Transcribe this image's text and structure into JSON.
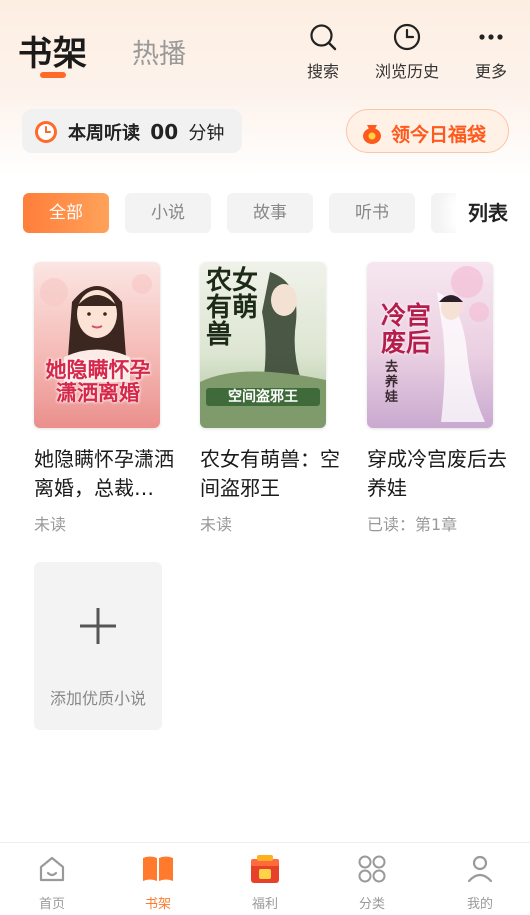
{
  "header": {
    "tabs": [
      {
        "label": "书架",
        "active": true
      },
      {
        "label": "热播",
        "active": false
      }
    ],
    "actions": [
      {
        "label": "搜索",
        "icon": "search-icon"
      },
      {
        "label": "浏览历史",
        "icon": "clock-icon"
      },
      {
        "label": "更多",
        "icon": "more-icon"
      }
    ]
  },
  "stats": {
    "label": "本周听读",
    "value": "00",
    "unit": "分钟",
    "bag_label": "领今日福袋"
  },
  "filters": {
    "chips": [
      "全部",
      "小说",
      "故事",
      "听书"
    ],
    "active": "全部",
    "view_toggle": "列表"
  },
  "books": [
    {
      "title": "她隐瞒怀孕潇洒离婚，总裁…",
      "status": "未读",
      "cover_text": "她隐瞒怀孕潇洒离婚",
      "cover_colors": [
        "#f9d6d4",
        "#f2a7a4"
      ]
    },
    {
      "title": "农女有萌兽：空间盗邪王",
      "status": "未读",
      "cover_text": "农女有萌兽",
      "cover_subtext": "空间盗邪王",
      "cover_colors": [
        "#e8efe2",
        "#b5c9a2"
      ]
    },
    {
      "title": "穿成冷宫废后去养娃",
      "status": "已读：第1章",
      "cover_text": "冷宫废后",
      "cover_subtext": "去养娃",
      "cover_colors": [
        "#f6e3ee",
        "#d9b8d6"
      ]
    }
  ],
  "add_card": {
    "label": "添加优质小说"
  },
  "bottom_nav": [
    {
      "label": "首页",
      "icon": "home-icon",
      "active": false
    },
    {
      "label": "书架",
      "icon": "book-icon",
      "active": true
    },
    {
      "label": "福利",
      "icon": "gift-icon",
      "active": false
    },
    {
      "label": "分类",
      "icon": "grid-icon",
      "active": false
    },
    {
      "label": "我的",
      "icon": "user-icon",
      "active": false
    }
  ],
  "colors": {
    "accent": "#ff7a2c",
    "accent_dark": "#ff5a1e",
    "text": "#1a1a1a",
    "muted": "#999999"
  }
}
